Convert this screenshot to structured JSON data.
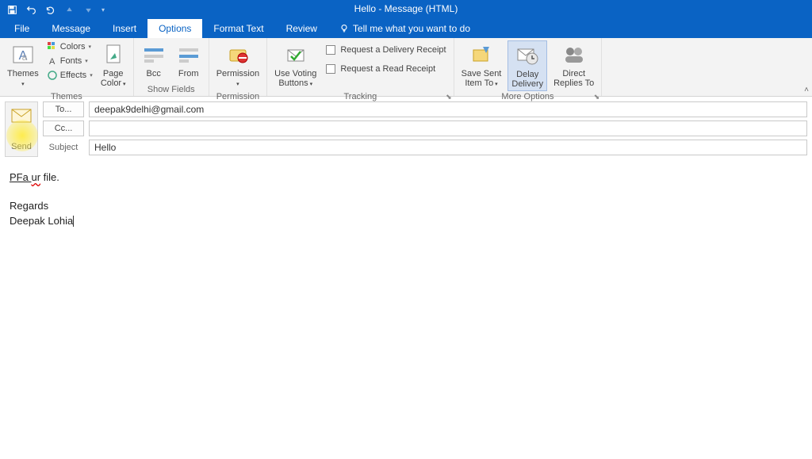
{
  "titlebar": {
    "title": "Hello  -  Message (HTML)"
  },
  "menubar": {
    "tabs": [
      "File",
      "Message",
      "Insert",
      "Options",
      "Format Text",
      "Review"
    ],
    "active_index": 3,
    "tell_me": "Tell me what you want to do"
  },
  "ribbon": {
    "themes": {
      "label": "Themes",
      "themes_btn": "Themes",
      "colors": "Colors",
      "fonts": "Fonts",
      "effects": "Effects",
      "page_color": "Page\nColor"
    },
    "show_fields": {
      "label": "Show Fields",
      "bcc": "Bcc",
      "from": "From"
    },
    "permission": {
      "label": "Permission",
      "btn": "Permission"
    },
    "tracking": {
      "label": "Tracking",
      "voting": "Use Voting\nButtons",
      "delivery_receipt": "Request a Delivery Receipt",
      "read_receipt": "Request a Read Receipt"
    },
    "more_options": {
      "label": "More Options",
      "save_sent": "Save Sent\nItem To",
      "delay": "Delay\nDelivery",
      "direct": "Direct\nReplies To"
    }
  },
  "compose": {
    "send": "Send",
    "to_label": "To...",
    "to_value": "deepak9delhi@gmail.com",
    "cc_label": "Cc...",
    "cc_value": "",
    "subject_label": "Subject",
    "subject_value": "Hello"
  },
  "body": {
    "line1_a": "PFa ",
    "line1_wavy": "ur",
    "line1_b": " file.",
    "line2": "Regards",
    "line3": "Deepak Lohia"
  }
}
